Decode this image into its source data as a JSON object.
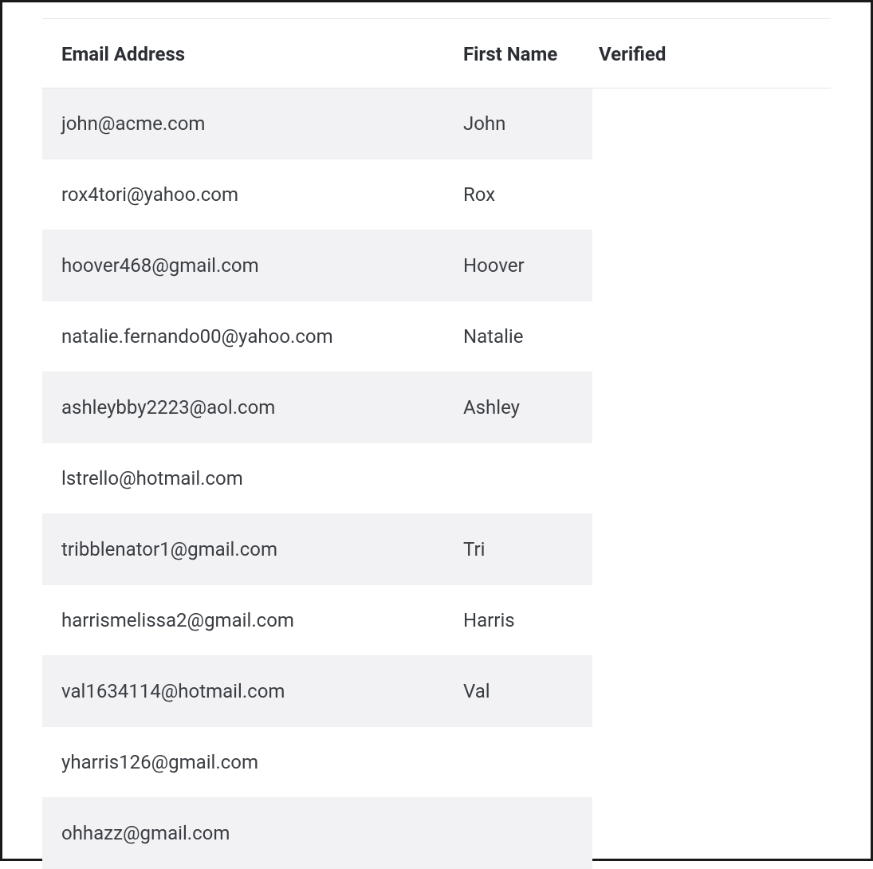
{
  "table": {
    "headers": {
      "email": "Email Address",
      "firstname": "First Name",
      "verified": "Verified"
    },
    "rows": [
      {
        "email": "john@acme.com",
        "firstname": "John"
      },
      {
        "email": "rox4tori@yahoo.com",
        "firstname": "Rox"
      },
      {
        "email": "hoover468@gmail.com",
        "firstname": "Hoover"
      },
      {
        "email": "natalie.fernando00@yahoo.com",
        "firstname": "Natalie"
      },
      {
        "email": "ashleybby2223@aol.com",
        "firstname": "Ashley"
      },
      {
        "email": "lstrello@hotmail.com",
        "firstname": ""
      },
      {
        "email": "tribblenator1@gmail.com",
        "firstname": "Tri"
      },
      {
        "email": "harrismelissa2@gmail.com",
        "firstname": "Harris"
      },
      {
        "email": "val1634114@hotmail.com",
        "firstname": "Val"
      },
      {
        "email": "yharris126@gmail.com",
        "firstname": ""
      },
      {
        "email": "ohhazz@gmail.com",
        "firstname": ""
      }
    ]
  }
}
